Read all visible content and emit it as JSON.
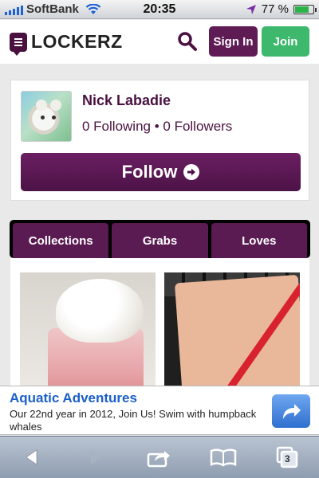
{
  "status_bar": {
    "carrier": "SoftBank",
    "time": "20:35",
    "battery_percent": "77 %",
    "battery_level": 0.77
  },
  "header": {
    "logo_text": "LOCKERZ",
    "sign_in_label": "Sign In",
    "join_label": "Join",
    "brand_color": "#5e1b54",
    "join_color": "#3db86d"
  },
  "profile": {
    "name": "Nick Labadie",
    "stats": "0 Following • 0 Followers",
    "follow_label": "Follow"
  },
  "tabs": [
    {
      "label": "Collections"
    },
    {
      "label": "Grabs"
    },
    {
      "label": "Loves"
    }
  ],
  "ad": {
    "title": "Aquatic Adventures",
    "text": "Our 22nd year in 2012, Join Us! Swim with humpback whales"
  },
  "toolbar": {
    "tab_count": "3"
  }
}
